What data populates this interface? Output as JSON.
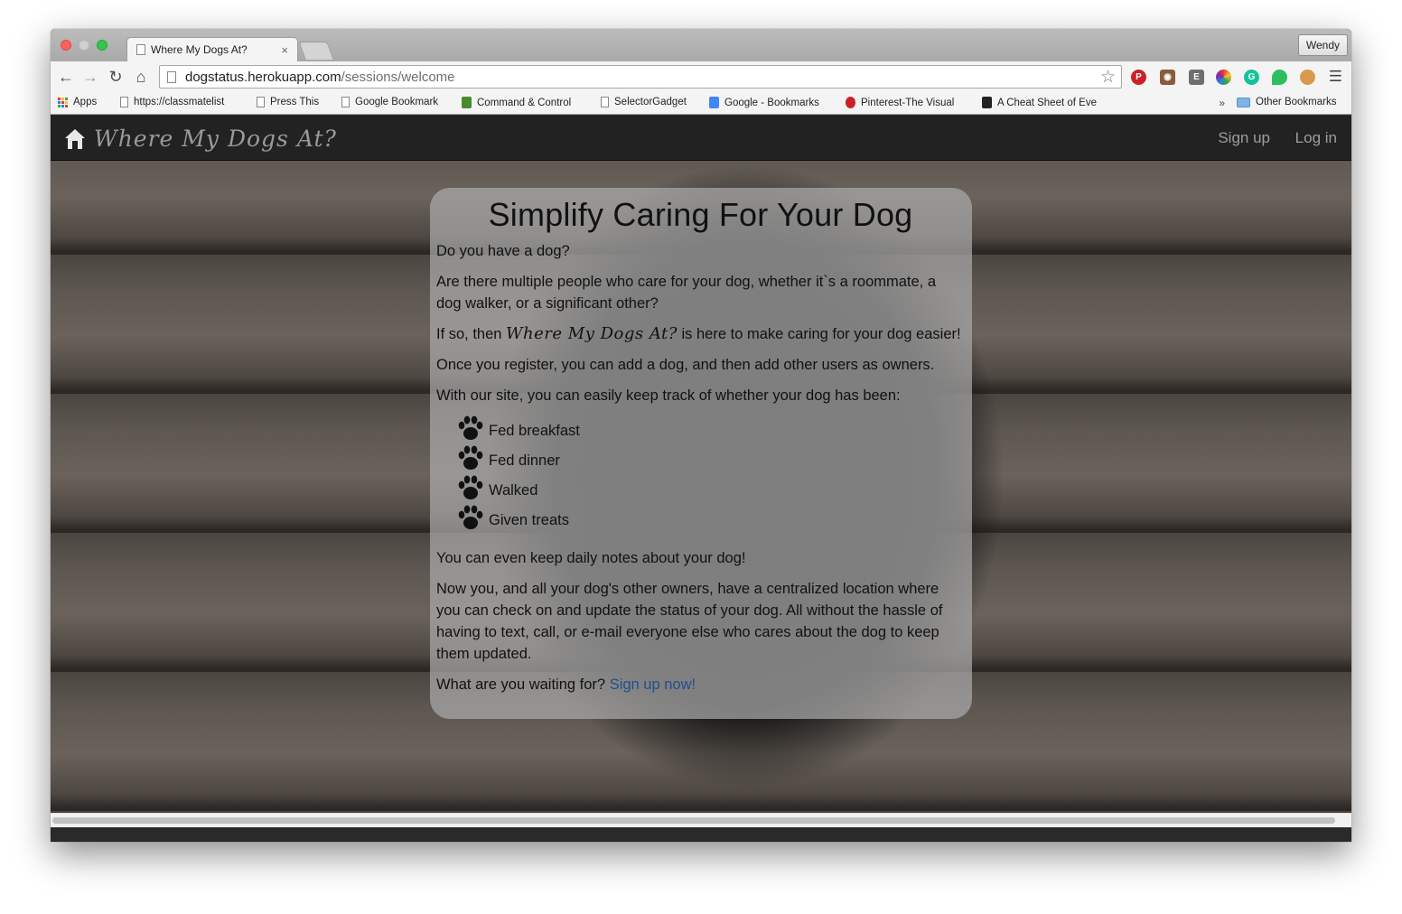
{
  "browser": {
    "tab_title": "Where My Dogs At?",
    "tab_close": "×",
    "user_button": "Wendy",
    "url_host": "dogstatus.herokuapp.com",
    "url_path": "/sessions/welcome"
  },
  "bookmarks": {
    "apps": "Apps",
    "items": [
      "https://classmatelist",
      "Press This",
      "Google Bookmark",
      "Command & Control",
      "SelectorGadget",
      "Google - Bookmarks",
      "Pinterest-The Visual",
      "A Cheat Sheet of Eve"
    ],
    "overflow": "»",
    "other": "Other Bookmarks"
  },
  "navbar": {
    "brand": "Where My Dogs At?",
    "signup": "Sign up",
    "login": "Log in"
  },
  "card": {
    "title": "Simplify Caring For Your Dog",
    "p1": "Do you have a dog?",
    "p2": "Are there multiple people who care for your dog, whether it`s a roommate, a dog walker, or a significant other?",
    "p3_before": "If so, then ",
    "p3_brand": "Where My Dogs At?",
    "p3_after": " is here to make caring for your dog easier!",
    "p4": "Once you register, you can add a dog, and then add other users as owners.",
    "p5": "With our site, you can easily keep track of whether your dog has been:",
    "checklist": [
      "Fed breakfast",
      "Fed dinner",
      "Walked",
      "Given treats"
    ],
    "p6": "You can even keep daily notes about your dog!",
    "p7": "Now you, and all your dog's other owners, have a centralized location where you can check on and update the status of your dog. All without the hassle of having to text, call, or e-mail everyone else who cares about the dog to keep them updated.",
    "p8_before": "What are you waiting for? ",
    "p8_link": "Sign up now!"
  },
  "colors": {
    "navbar_bg": "#222222",
    "link": "#1e4f8e",
    "card_bg": "rgba(170,170,170,0.72)"
  }
}
